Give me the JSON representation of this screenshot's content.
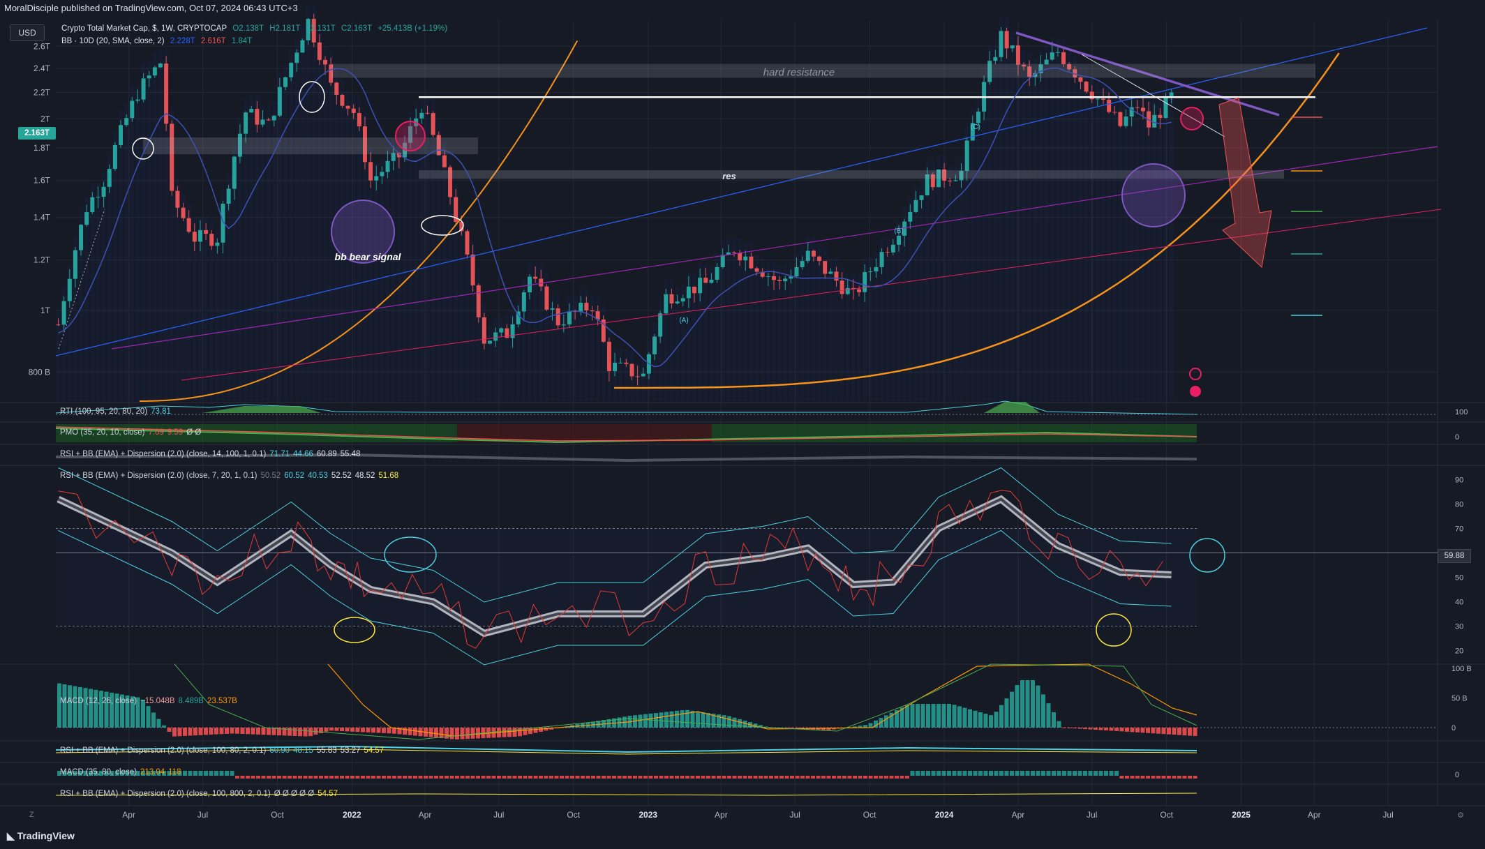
{
  "header": {
    "published": "MoralDisciple published on TradingView.com, Oct 07, 2024 06:43 UTC+3",
    "currency_button": "USD",
    "brand": "TradingView"
  },
  "legends": {
    "main": {
      "name": "Crypto Total Market Cap, $, 1W, CRYPTOCAP",
      "o": "O2.138T",
      "h": "H2.181T",
      "l": "L2.131T",
      "c": "C2.163T",
      "change": "+25.413B (+1.19%)"
    },
    "bb": {
      "name": "BB · 10D (20, SMA, close, 2)",
      "v1": "2.228T",
      "v2": "2.616T",
      "v3": "1.84T"
    },
    "rti": {
      "name": "RTI (100, 95, 20, 80, 20)",
      "v": "73.81"
    },
    "pmo": {
      "name": "PMO (35, 20, 10, close)",
      "v1": "7.69",
      "v2": "9.59",
      "v3": "Ø Ø"
    },
    "rsi1": {
      "name": "RSI + BB (EMA) + Dispersion (2.0) (close, 14, 100, 1, 0.1)",
      "vals": [
        "71.71",
        "44.66",
        "60.89",
        "55.48"
      ]
    },
    "rsi2": {
      "name": "RSI + BB (EMA) + Dispersion (2.0) (close, 7, 20, 1, 0.1)",
      "vals": [
        "50.52",
        "60.52",
        "40.53",
        "52.52",
        "48.52",
        "51.68"
      ]
    },
    "macd1": {
      "name": "MACD (12, 26, close)",
      "vals": [
        "−15.048B",
        "8.489B",
        "23.537B"
      ]
    },
    "rsi3": {
      "name": "RSI + BB (EMA) + Dispersion (2.0) (close, 100, 80, 2, 0.1)",
      "vals": [
        "60.90",
        "48.15",
        "55.83",
        "53.27",
        "54.57"
      ]
    },
    "macd2": {
      "name": "MACD (35, 80, close)",
      "vals": [
        "213.04",
        "118"
      ]
    },
    "rsi4": {
      "name": "RSI + BB (EMA) + Dispersion (2.0) (close, 100, 800, 2, 0.1)",
      "vals": [
        "Ø Ø Ø Ø Ø",
        "54.57"
      ]
    }
  },
  "price_tag": "2.163T",
  "rsi_tag": "59.88",
  "corners": {
    "left": "Z",
    "right": "⚙"
  },
  "annotations": {
    "hard_resistance": "hard resistance",
    "res": "res",
    "bb_bear_signal": "bb bear signal",
    "wave_a": "(A)",
    "wave_b": "(B)",
    "wave_c": "(C)"
  },
  "colors": {
    "bg": "#161a25",
    "up": "#26a69a",
    "down": "#ef5350",
    "bb": "#2962ff",
    "orange": "#f7931a",
    "purple": "#9c27b0",
    "grid": "#242833"
  },
  "chart_data": {
    "type": "candlestick",
    "title": "Crypto Total Market Cap, $, 1W, CRYPTOCAP",
    "x_axis_labels": [
      "Apr",
      "Jul",
      "Oct",
      "2022",
      "Apr",
      "Jul",
      "Oct",
      "2023",
      "Apr",
      "Jul",
      "Oct",
      "2024",
      "Apr",
      "Jul",
      "Oct",
      "2025",
      "Apr",
      "Jul"
    ],
    "y_axis_labels": [
      "800 B",
      "1T",
      "1.2T",
      "1.4T",
      "1.6T",
      "1.8T",
      "2T",
      "2.2T",
      "2.4T",
      "2.6T"
    ],
    "y_scale": "log",
    "ylim": [
      0.72,
      2.85
    ],
    "y_unit": "T USD",
    "price_series": [
      [
        "2021-01-04",
        0.95
      ],
      [
        "2021-02-08",
        1.45
      ],
      [
        "2021-03-01",
        1.6
      ],
      [
        "2021-04-12",
        2.2
      ],
      [
        "2021-05-10",
        2.45
      ],
      [
        "2021-05-24",
        1.5
      ],
      [
        "2021-06-21",
        1.3
      ],
      [
        "2021-07-19",
        1.3
      ],
      [
        "2021-08-23",
        2.05
      ],
      [
        "2021-09-20",
        1.95
      ],
      [
        "2021-10-18",
        2.45
      ],
      [
        "2021-11-08",
        2.85
      ],
      [
        "2021-12-06",
        2.25
      ],
      [
        "2022-01-03",
        2.05
      ],
      [
        "2022-01-24",
        1.6
      ],
      [
        "2022-03-01",
        1.75
      ],
      [
        "2022-03-28",
        2.1
      ],
      [
        "2022-05-09",
        1.4
      ],
      [
        "2022-06-13",
        0.9
      ],
      [
        "2022-07-11",
        0.92
      ],
      [
        "2022-08-08",
        1.13
      ],
      [
        "2022-09-12",
        0.96
      ],
      [
        "2022-10-24",
        1.02
      ],
      [
        "2022-11-14",
        0.82
      ],
      [
        "2022-12-26",
        0.79
      ],
      [
        "2023-01-23",
        1.05
      ],
      [
        "2023-03-13",
        1.1
      ],
      [
        "2023-04-17",
        1.25
      ],
      [
        "2023-06-12",
        1.1
      ],
      [
        "2023-07-17",
        1.22
      ],
      [
        "2023-09-11",
        1.05
      ],
      [
        "2023-10-30",
        1.3
      ],
      [
        "2023-12-11",
        1.6
      ],
      [
        "2024-01-22",
        1.65
      ],
      [
        "2024-02-26",
        2.4
      ],
      [
        "2024-03-11",
        2.7
      ],
      [
        "2024-04-15",
        2.3
      ],
      [
        "2024-05-20",
        2.55
      ],
      [
        "2024-06-24",
        2.25
      ],
      [
        "2024-08-05",
        1.95
      ],
      [
        "2024-08-26",
        2.1
      ],
      [
        "2024-09-09",
        1.95
      ],
      [
        "2024-10-07",
        2.163
      ]
    ],
    "levels": {
      "hard_resistance": [
        2.32,
        2.44
      ],
      "res": [
        1.61,
        1.66
      ],
      "white_line": 2.163
    },
    "rsi_series": [
      [
        "2021-01-04",
        82
      ],
      [
        "2021-05-24",
        60
      ],
      [
        "2021-07-19",
        48
      ],
      [
        "2021-10-18",
        68
      ],
      [
        "2021-12-06",
        55
      ],
      [
        "2022-01-24",
        45
      ],
      [
        "2022-04-11",
        40
      ],
      [
        "2022-06-13",
        27
      ],
      [
        "2022-09-12",
        35
      ],
      [
        "2022-12-26",
        35
      ],
      [
        "2023-03-13",
        55
      ],
      [
        "2023-05-22",
        58
      ],
      [
        "2023-07-17",
        62
      ],
      [
        "2023-09-11",
        47
      ],
      [
        "2023-10-30",
        48
      ],
      [
        "2023-12-25",
        70
      ],
      [
        "2024-03-11",
        82
      ],
      [
        "2024-05-20",
        63
      ],
      [
        "2024-08-05",
        52
      ],
      [
        "2024-10-07",
        51
      ]
    ],
    "rsi_yaxis": [
      "90",
      "80",
      "70",
      "60",
      "50",
      "40",
      "30",
      "20"
    ],
    "macd_yaxis": [
      "100 B",
      "50 B",
      "0"
    ],
    "rti_yaxis": [
      "100",
      "0"
    ],
    "pmo_yaxis": [
      "0"
    ],
    "macd2_yaxis": [
      "0"
    ]
  }
}
